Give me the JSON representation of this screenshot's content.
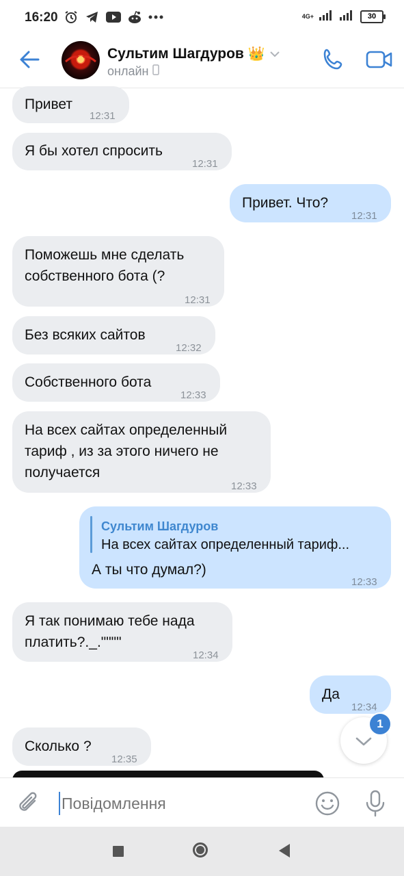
{
  "status_bar": {
    "time": "16:20",
    "network": "4G+",
    "battery": "30"
  },
  "header": {
    "contact_name": "Сультим Шагдуров",
    "crown": "👑",
    "status": "онлайн"
  },
  "messages": [
    {
      "dir": "in",
      "lines": [
        "Привет"
      ],
      "time": "12:31"
    },
    {
      "dir": "in",
      "lines": [
        "Я бы хотел спросить"
      ],
      "time": "12:31"
    },
    {
      "dir": "out",
      "lines": [
        "Привет. Что?"
      ],
      "time": "12:31"
    },
    {
      "dir": "in",
      "lines": [
        "Поможешь мне сделать",
        "собственного бота (?"
      ],
      "time": "12:31"
    },
    {
      "dir": "in",
      "lines": [
        "Без всяких сайтов"
      ],
      "time": "12:32"
    },
    {
      "dir": "in",
      "lines": [
        "Собственного бота"
      ],
      "time": "12:33"
    },
    {
      "dir": "in",
      "lines": [
        "На всех сайтах определенный",
        "тариф , из за этого ничего не",
        "получается"
      ],
      "time": "12:33"
    },
    {
      "dir": "out",
      "reply": {
        "name": "Сультим Шагдуров",
        "text": "На всех сайтах определенный тариф..."
      },
      "lines": [
        "А ты что думал?)"
      ],
      "time": "12:33"
    },
    {
      "dir": "in",
      "lines": [
        "Я так понимаю тебе нада",
        "платить?._.\"\"\"\""
      ],
      "time": "12:34"
    },
    {
      "dir": "out",
      "lines": [
        "Да"
      ],
      "time": "12:34"
    },
    {
      "dir": "in",
      "lines": [
        "Сколько ?"
      ],
      "time": "12:35"
    }
  ],
  "scroll_down": {
    "unread_count": "1"
  },
  "input": {
    "placeholder": "Повідомлення"
  },
  "icons": {
    "back": "arrow-left-icon",
    "call": "phone-icon",
    "video": "video-camera-icon",
    "attach": "paperclip-icon",
    "emoji": "smiley-icon",
    "mic": "microphone-icon"
  },
  "colors": {
    "accent": "#3c82d4",
    "incoming_bubble": "#ebedf0",
    "outgoing_bubble": "#cce4ff",
    "reply_name": "#3f87cf"
  }
}
